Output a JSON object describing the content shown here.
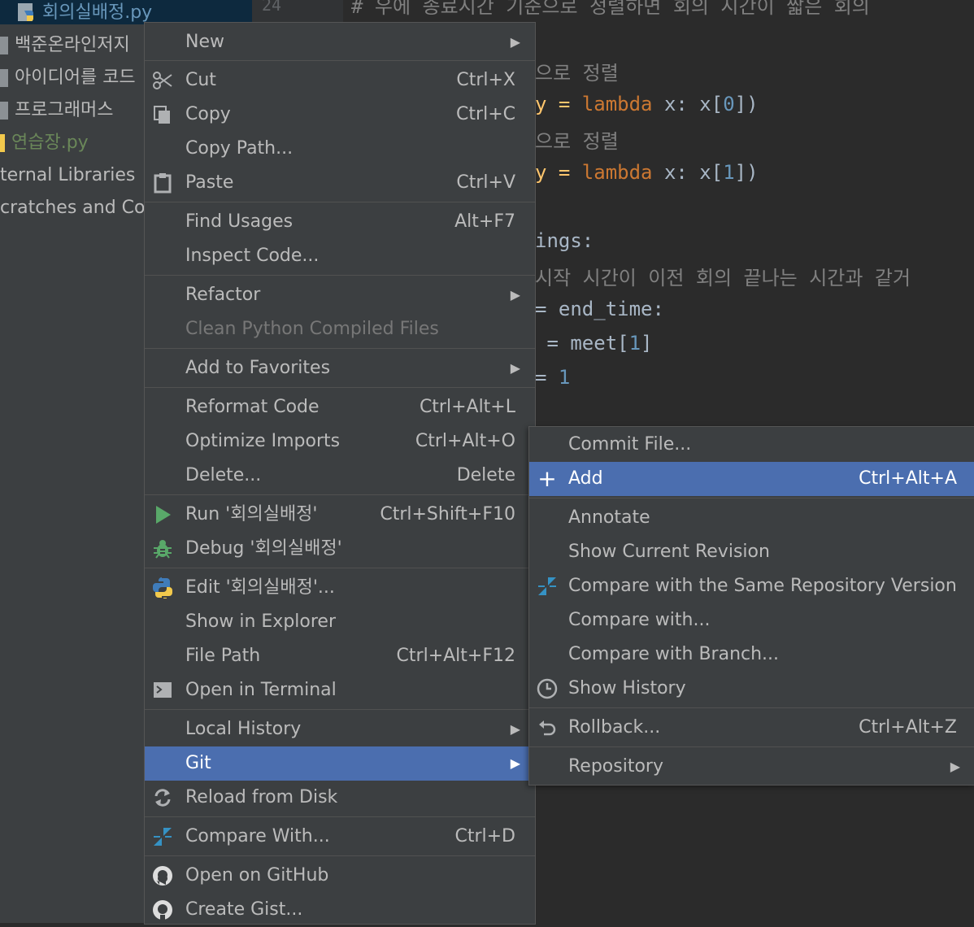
{
  "tree": {
    "selected_file": "회의실배정.py",
    "items": [
      "백준온라인저지",
      "아이디어를 코드",
      "프로그래머스",
      "연습장.py",
      "ternal Libraries",
      "cratches and Con"
    ]
  },
  "editor": {
    "line_number": "24",
    "lines": {
      "l0": "# 우에 종료시간 기준으로 정렬하면 회의 시간이 짧은 회의",
      "l1": "으로 정렬",
      "l2a": "y = ",
      "l2b": "lambda",
      "l2c": " x: x[",
      "l2d": "0",
      "l2e": "])",
      "l3": "으로 정렬",
      "l4a": "y = ",
      "l4b": "lambda",
      "l4c": " x: x[",
      "l4d": "1",
      "l4e": "])",
      "l5": "ings:",
      "l6": "시작 시간이 이전 회의 끝나는 시간과 같거",
      "l7": "= end_time:",
      "l8a": " = meet[",
      "l8b": "1",
      "l8c": "]",
      "l9a": "= ",
      "l9b": "1"
    }
  },
  "context_menu": {
    "items": {
      "new": {
        "label": "New"
      },
      "cut": {
        "label": "Cut",
        "shortcut": "Ctrl+X"
      },
      "copy": {
        "label": "Copy",
        "shortcut": "Ctrl+C"
      },
      "copy_path": {
        "label": "Copy Path..."
      },
      "paste": {
        "label": "Paste",
        "shortcut": "Ctrl+V"
      },
      "find_usages": {
        "label": "Find Usages",
        "shortcut": "Alt+F7"
      },
      "inspect_code": {
        "label": "Inspect Code..."
      },
      "refactor": {
        "label": "Refactor"
      },
      "clean_python": {
        "label": "Clean Python Compiled Files"
      },
      "add_favorites": {
        "label": "Add to Favorites"
      },
      "reformat": {
        "label": "Reformat Code",
        "shortcut": "Ctrl+Alt+L"
      },
      "optimize": {
        "label": "Optimize Imports",
        "shortcut": "Ctrl+Alt+O"
      },
      "delete": {
        "label": "Delete...",
        "shortcut": "Delete"
      },
      "run": {
        "label": "Run '회의실배정'",
        "shortcut": "Ctrl+Shift+F10"
      },
      "debug": {
        "label": "Debug '회의실배정'"
      },
      "edit": {
        "label": "Edit '회의실배정'..."
      },
      "show_explorer": {
        "label": "Show in Explorer"
      },
      "file_path": {
        "label": "File Path",
        "shortcut": "Ctrl+Alt+F12"
      },
      "open_terminal": {
        "label": "Open in Terminal"
      },
      "local_history": {
        "label": "Local History"
      },
      "git": {
        "label": "Git"
      },
      "reload": {
        "label": "Reload from Disk"
      },
      "compare_with": {
        "label": "Compare With...",
        "shortcut": "Ctrl+D"
      },
      "open_github": {
        "label": "Open on GitHub"
      },
      "create_gist": {
        "label": "Create Gist..."
      }
    }
  },
  "git_menu": {
    "items": {
      "commit": {
        "label": "Commit File..."
      },
      "add": {
        "label": "Add",
        "shortcut": "Ctrl+Alt+A"
      },
      "annotate": {
        "label": "Annotate"
      },
      "show_revision": {
        "label": "Show Current Revision"
      },
      "compare_repo": {
        "label": "Compare with the Same Repository Version"
      },
      "compare_with": {
        "label": "Compare with..."
      },
      "compare_branch": {
        "label": "Compare with Branch..."
      },
      "show_history": {
        "label": "Show History"
      },
      "rollback": {
        "label": "Rollback...",
        "shortcut": "Ctrl+Alt+Z"
      },
      "repository": {
        "label": "Repository"
      }
    }
  },
  "colors": {
    "menu_bg": "#3c3f41",
    "selection": "#4b6eaf",
    "run_green": "#59a869",
    "compare_blue": "#3592c4",
    "python_blue": "#3f7cba",
    "python_yellow": "#f2c94c"
  },
  "icons": {
    "cut": "scissors-icon",
    "copy": "copy-icon",
    "paste": "clipboard-icon",
    "run": "play-icon",
    "debug": "bug-icon",
    "edit": "python-icon",
    "terminal": "terminal-icon",
    "reload": "reload-icon",
    "compare": "compare-arrows-icon",
    "github": "github-icon",
    "add": "plus-icon",
    "history": "clock-icon",
    "rollback": "undo-icon"
  }
}
